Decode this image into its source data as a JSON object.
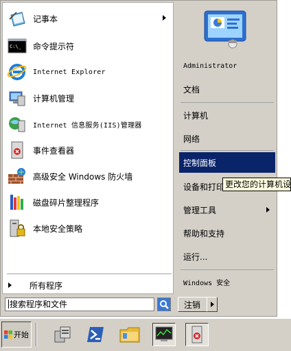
{
  "left_programs": [
    {
      "label": "记事本",
      "icon": "notepad-icon",
      "submenu": true
    },
    {
      "label": "命令提示符",
      "icon": "command-prompt-icon",
      "submenu": false
    },
    {
      "label": "Internet Explorer",
      "icon": "internet-explorer-icon",
      "submenu": false
    },
    {
      "label": "计算机管理",
      "icon": "computer-management-icon",
      "submenu": false
    },
    {
      "label": "Internet 信息服务(IIS)管理器",
      "icon": "iis-manager-icon",
      "submenu": false
    },
    {
      "label": "事件查看器",
      "icon": "event-viewer-icon",
      "submenu": false
    },
    {
      "label": "高级安全 Windows 防火墙",
      "icon": "firewall-icon",
      "submenu": false
    },
    {
      "label": "磁盘碎片整理程序",
      "icon": "disk-defragmenter-icon",
      "submenu": false
    },
    {
      "label": "本地安全策略",
      "icon": "local-security-policy-icon",
      "submenu": false
    }
  ],
  "all_programs_label": "所有程序",
  "search": {
    "placeholder": "搜索程序和文件",
    "icon": "search-icon"
  },
  "right_items": [
    {
      "label": "Administrator",
      "submenu": false,
      "selected": false
    },
    {
      "label": "文档",
      "submenu": false,
      "selected": false
    },
    {
      "label": "计算机",
      "submenu": false,
      "selected": false
    },
    {
      "label": "网络",
      "submenu": false,
      "selected": false
    },
    {
      "label": "控制面板",
      "submenu": false,
      "selected": true
    },
    {
      "label": "设备和打印机",
      "submenu": false,
      "selected": false
    },
    {
      "label": "管理工具",
      "submenu": true,
      "selected": false
    },
    {
      "label": "帮助和支持",
      "submenu": false,
      "selected": false
    },
    {
      "label": "运行...",
      "submenu": false,
      "selected": false
    },
    {
      "label": "Windows 安全",
      "submenu": false,
      "selected": false
    }
  ],
  "user_picture_icon": "user-picture-icon",
  "tooltip_text": "更改您的计算机设置并自定义其功能。",
  "logoff_label": "注销",
  "start_button_label": "开始",
  "taskbar_icons": [
    "server-manager-icon",
    "powershell-icon",
    "file-explorer-icon",
    "performance-monitor-icon",
    "event-viewer-icon"
  ],
  "colors": {
    "selection": "#0a246a",
    "menu_bg": "#d4d0c8",
    "tooltip_bg": "#ffffe1"
  }
}
